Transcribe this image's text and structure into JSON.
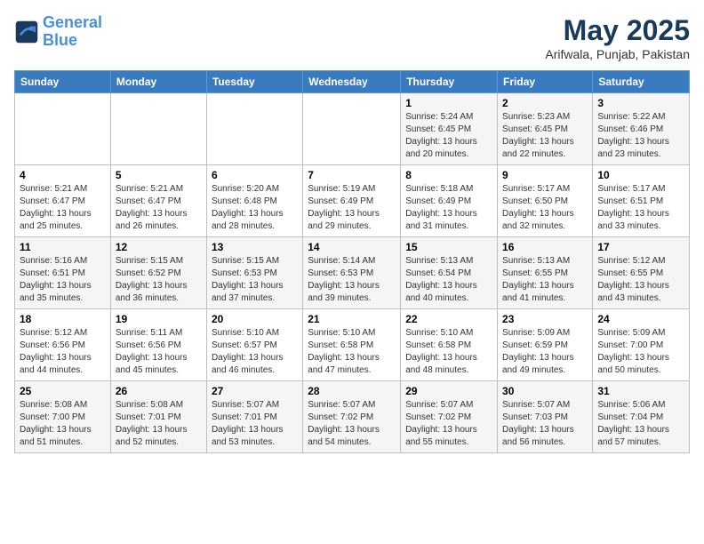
{
  "header": {
    "logo_line1": "General",
    "logo_line2": "Blue",
    "month": "May 2025",
    "location": "Arifwala, Punjab, Pakistan"
  },
  "weekdays": [
    "Sunday",
    "Monday",
    "Tuesday",
    "Wednesday",
    "Thursday",
    "Friday",
    "Saturday"
  ],
  "weeks": [
    [
      {
        "day": "",
        "info": ""
      },
      {
        "day": "",
        "info": ""
      },
      {
        "day": "",
        "info": ""
      },
      {
        "day": "",
        "info": ""
      },
      {
        "day": "1",
        "info": "Sunrise: 5:24 AM\nSunset: 6:45 PM\nDaylight: 13 hours and 20 minutes."
      },
      {
        "day": "2",
        "info": "Sunrise: 5:23 AM\nSunset: 6:45 PM\nDaylight: 13 hours and 22 minutes."
      },
      {
        "day": "3",
        "info": "Sunrise: 5:22 AM\nSunset: 6:46 PM\nDaylight: 13 hours and 23 minutes."
      }
    ],
    [
      {
        "day": "4",
        "info": "Sunrise: 5:21 AM\nSunset: 6:47 PM\nDaylight: 13 hours and 25 minutes."
      },
      {
        "day": "5",
        "info": "Sunrise: 5:21 AM\nSunset: 6:47 PM\nDaylight: 13 hours and 26 minutes."
      },
      {
        "day": "6",
        "info": "Sunrise: 5:20 AM\nSunset: 6:48 PM\nDaylight: 13 hours and 28 minutes."
      },
      {
        "day": "7",
        "info": "Sunrise: 5:19 AM\nSunset: 6:49 PM\nDaylight: 13 hours and 29 minutes."
      },
      {
        "day": "8",
        "info": "Sunrise: 5:18 AM\nSunset: 6:49 PM\nDaylight: 13 hours and 31 minutes."
      },
      {
        "day": "9",
        "info": "Sunrise: 5:17 AM\nSunset: 6:50 PM\nDaylight: 13 hours and 32 minutes."
      },
      {
        "day": "10",
        "info": "Sunrise: 5:17 AM\nSunset: 6:51 PM\nDaylight: 13 hours and 33 minutes."
      }
    ],
    [
      {
        "day": "11",
        "info": "Sunrise: 5:16 AM\nSunset: 6:51 PM\nDaylight: 13 hours and 35 minutes."
      },
      {
        "day": "12",
        "info": "Sunrise: 5:15 AM\nSunset: 6:52 PM\nDaylight: 13 hours and 36 minutes."
      },
      {
        "day": "13",
        "info": "Sunrise: 5:15 AM\nSunset: 6:53 PM\nDaylight: 13 hours and 37 minutes."
      },
      {
        "day": "14",
        "info": "Sunrise: 5:14 AM\nSunset: 6:53 PM\nDaylight: 13 hours and 39 minutes."
      },
      {
        "day": "15",
        "info": "Sunrise: 5:13 AM\nSunset: 6:54 PM\nDaylight: 13 hours and 40 minutes."
      },
      {
        "day": "16",
        "info": "Sunrise: 5:13 AM\nSunset: 6:55 PM\nDaylight: 13 hours and 41 minutes."
      },
      {
        "day": "17",
        "info": "Sunrise: 5:12 AM\nSunset: 6:55 PM\nDaylight: 13 hours and 43 minutes."
      }
    ],
    [
      {
        "day": "18",
        "info": "Sunrise: 5:12 AM\nSunset: 6:56 PM\nDaylight: 13 hours and 44 minutes."
      },
      {
        "day": "19",
        "info": "Sunrise: 5:11 AM\nSunset: 6:56 PM\nDaylight: 13 hours and 45 minutes."
      },
      {
        "day": "20",
        "info": "Sunrise: 5:10 AM\nSunset: 6:57 PM\nDaylight: 13 hours and 46 minutes."
      },
      {
        "day": "21",
        "info": "Sunrise: 5:10 AM\nSunset: 6:58 PM\nDaylight: 13 hours and 47 minutes."
      },
      {
        "day": "22",
        "info": "Sunrise: 5:10 AM\nSunset: 6:58 PM\nDaylight: 13 hours and 48 minutes."
      },
      {
        "day": "23",
        "info": "Sunrise: 5:09 AM\nSunset: 6:59 PM\nDaylight: 13 hours and 49 minutes."
      },
      {
        "day": "24",
        "info": "Sunrise: 5:09 AM\nSunset: 7:00 PM\nDaylight: 13 hours and 50 minutes."
      }
    ],
    [
      {
        "day": "25",
        "info": "Sunrise: 5:08 AM\nSunset: 7:00 PM\nDaylight: 13 hours and 51 minutes."
      },
      {
        "day": "26",
        "info": "Sunrise: 5:08 AM\nSunset: 7:01 PM\nDaylight: 13 hours and 52 minutes."
      },
      {
        "day": "27",
        "info": "Sunrise: 5:07 AM\nSunset: 7:01 PM\nDaylight: 13 hours and 53 minutes."
      },
      {
        "day": "28",
        "info": "Sunrise: 5:07 AM\nSunset: 7:02 PM\nDaylight: 13 hours and 54 minutes."
      },
      {
        "day": "29",
        "info": "Sunrise: 5:07 AM\nSunset: 7:02 PM\nDaylight: 13 hours and 55 minutes."
      },
      {
        "day": "30",
        "info": "Sunrise: 5:07 AM\nSunset: 7:03 PM\nDaylight: 13 hours and 56 minutes."
      },
      {
        "day": "31",
        "info": "Sunrise: 5:06 AM\nSunset: 7:04 PM\nDaylight: 13 hours and 57 minutes."
      }
    ]
  ]
}
